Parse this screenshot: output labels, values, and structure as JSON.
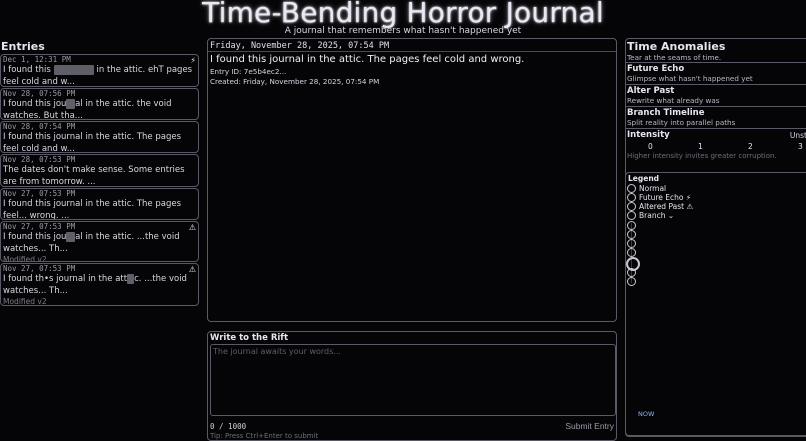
{
  "header": {
    "title": "Time-Bending Horror Journal",
    "subtitle": "A journal that remembers what hasn't happened yet"
  },
  "entries": {
    "heading": "Entries",
    "items": [
      {
        "ts": "Dec 1, 12:31 PM",
        "flag": "⚡",
        "pre": "I found this ",
        "hidden": "▫▫▫▫▫▫▫",
        "post": " in the attic. ehT pages feel cold and w...",
        "mod": ""
      },
      {
        "ts": "Nov 28, 07:56 PM",
        "flag": "",
        "pre": "I found this jou",
        "hidden": "rn",
        "post": "al in the attic. the void watches. But tha...",
        "mod": ""
      },
      {
        "ts": "Nov 28, 07:54 PM",
        "flag": "",
        "pre": "I found this journal in the attic. The pages feel cold and w...",
        "hidden": "",
        "post": "",
        "mod": ""
      },
      {
        "ts": "Nov 28, 07:53 PM",
        "flag": "",
        "pre": "The dates don't make sense. Some entries are from tomorrow. ...",
        "hidden": "",
        "post": "",
        "mod": ""
      },
      {
        "ts": "Nov 27, 07:53 PM",
        "flag": "",
        "pre": "I found this journal in the attic. The pages feel... wrong. ...",
        "hidden": "",
        "post": "",
        "mod": ""
      },
      {
        "ts": "Nov 27, 07:53 PM",
        "flag": "⚠",
        "pre": "I found this jou",
        "hidden": "rn",
        "post": "al in the attic. ...the void watches... Th...",
        "mod": "Modified v2"
      },
      {
        "ts": "Nov 27, 07:53 PM",
        "flag": "⚠",
        "pre": "I found th•s journal in the att",
        "hidden": "ic",
        "post": "c. ...the void",
        "post2_hidden": "  ",
        "post2": "watches... Th...",
        "mod": "Modified v2"
      }
    ]
  },
  "viewer": {
    "date": "Friday, November 28, 2025, 07:54 PM",
    "text": "I found this journal in the attic. The pages feel cold and wrong.",
    "entry_id": "Entry ID: 7e5b4ec2...",
    "created": "Created: Friday, November 28, 2025, 07:54 PM"
  },
  "composer": {
    "label": "Write to the Rift",
    "placeholder": "The journal awaits your words...",
    "count": "0 / 1000",
    "submit_label": "Submit Entry",
    "tip": "Tip: Press Ctrl+Enter to submit"
  },
  "anomalies": {
    "heading": "Time Anomalies",
    "subheading": "Tear at the seams of time.",
    "modes": [
      {
        "name": "Future Echo",
        "desc": "Glimpse what hasn't happened yet"
      },
      {
        "name": "Alter Past",
        "desc": "Rewrite what already was"
      },
      {
        "name": "Branch Timeline",
        "desc": "Split reality into parallel paths"
      }
    ],
    "intensity": {
      "label": "Intensity",
      "max_label": "Unst",
      "ticks": [
        "0",
        "1",
        "2",
        "3"
      ],
      "hint": "Higher intensity invites greater corruption."
    }
  },
  "legend": {
    "title": "Legend",
    "items": [
      {
        "label": "Normal"
      },
      {
        "label": "Future Echo ⚡"
      },
      {
        "label": "Altered Past ⚠"
      },
      {
        "label": "Branch ⌄"
      }
    ],
    "now_label": "NOW"
  },
  "colors": {
    "background": "#050508",
    "border": "#5a5a66",
    "accent": "#8ab4f8"
  }
}
